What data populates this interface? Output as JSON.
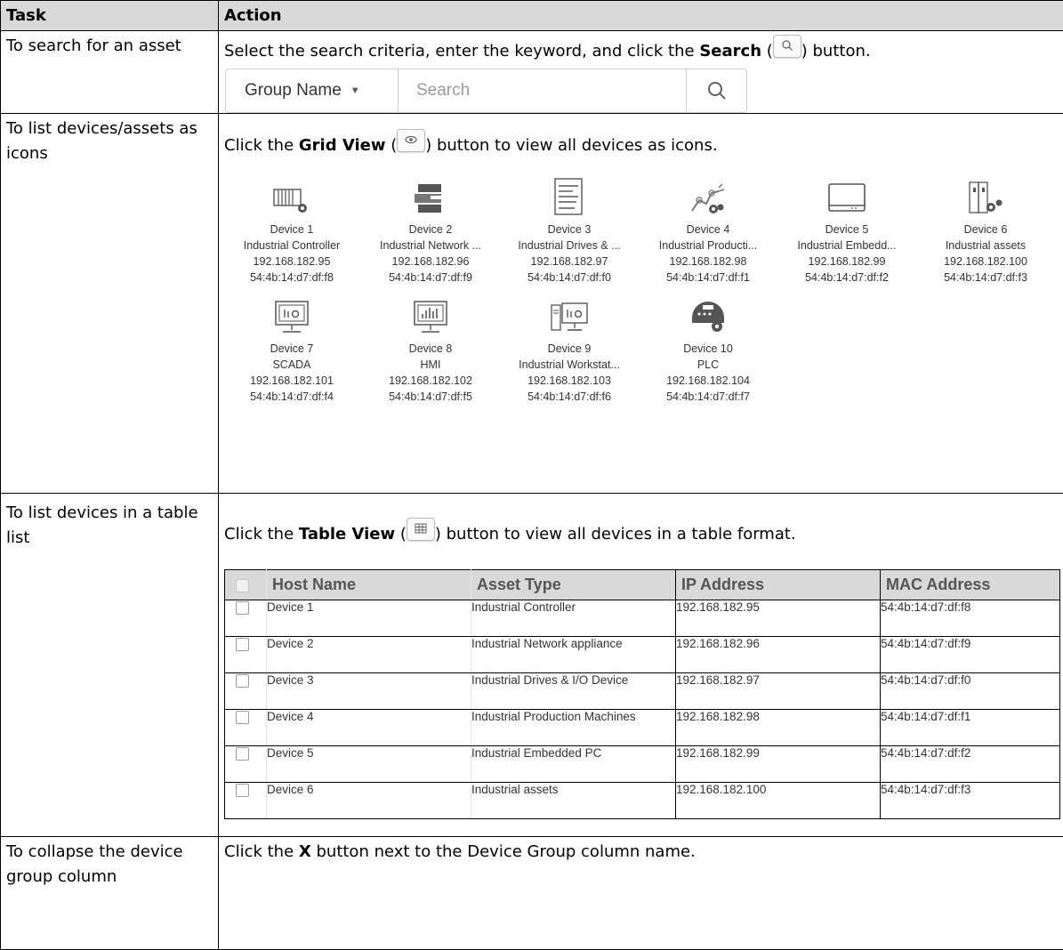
{
  "headers": {
    "task": "Task",
    "action": "Action"
  },
  "rows": {
    "search": {
      "task": "To search for an asset",
      "pre": "Select the search criteria, enter the keyword, and click the ",
      "bold": "Search",
      "open": " (",
      "post": ") button.",
      "widget": {
        "select": "Group Name",
        "placeholder": "Search"
      }
    },
    "grid": {
      "task": "To list devices/assets as icons",
      "pre": "Click the ",
      "bold": "Grid View",
      "open": " (",
      "post": ") button to view all devices as icons.",
      "devices": [
        {
          "name": "Device 1",
          "type": "Industrial Controller",
          "ip": "192.168.182.95",
          "mac": "54:4b:14:d7:df:f8",
          "icon": "controller-icon"
        },
        {
          "name": "Device 2",
          "type": "Industrial Network ...",
          "ip": "192.168.182.96",
          "mac": "54:4b:14:d7:df:f9",
          "icon": "network-appliance-icon"
        },
        {
          "name": "Device 3",
          "type": "Industrial Drives & ...",
          "ip": "192.168.182.97",
          "mac": "54:4b:14:d7:df:f0",
          "icon": "drives-io-icon"
        },
        {
          "name": "Device 4",
          "type": "Industrial Producti...",
          "ip": "192.168.182.98",
          "mac": "54:4b:14:d7:df:f1",
          "icon": "robot-arm-icon"
        },
        {
          "name": "Device 5",
          "type": "Industrial Embedd...",
          "ip": "192.168.182.99",
          "mac": "54:4b:14:d7:df:f2",
          "icon": "embedded-pc-icon"
        },
        {
          "name": "Device 6",
          "type": "Industrial assets",
          "ip": "192.168.182.100",
          "mac": "54:4b:14:d7:df:f3",
          "icon": "industrial-assets-icon"
        },
        {
          "name": "Device 7",
          "type": "SCADA",
          "ip": "192.168.182.101",
          "mac": "54:4b:14:d7:df:f4",
          "icon": "scada-monitor-icon"
        },
        {
          "name": "Device 8",
          "type": "HMI",
          "ip": "192.168.182.102",
          "mac": "54:4b:14:d7:df:f5",
          "icon": "hmi-monitor-icon"
        },
        {
          "name": "Device 9",
          "type": "Industrial Workstat...",
          "ip": "192.168.182.103",
          "mac": "54:4b:14:d7:df:f6",
          "icon": "workstation-icon"
        },
        {
          "name": "Device 10",
          "type": "PLC",
          "ip": "192.168.182.104",
          "mac": "54:4b:14:d7:df:f7",
          "icon": "plc-icon"
        }
      ]
    },
    "table": {
      "task": "To list devices in a table list",
      "pre": "Click the ",
      "bold": "Table View",
      "open": " (",
      "post": ") button to view all devices in a table format.",
      "columns": [
        "Host Name",
        "Asset Type",
        "IP Address",
        "MAC Address"
      ],
      "rows": [
        [
          "Device 1",
          "Industrial Controller",
          "192.168.182.95",
          "54:4b:14:d7:df:f8"
        ],
        [
          "Device 2",
          "Industrial Network appliance",
          "192.168.182.96",
          "54:4b:14:d7:df:f9"
        ],
        [
          "Device 3",
          "Industrial Drives & I/O Device",
          "192.168.182.97",
          "54:4b:14:d7:df:f0"
        ],
        [
          "Device 4",
          "Industrial Production Machines",
          "192.168.182.98",
          "54:4b:14:d7:df:f1"
        ],
        [
          "Device 5",
          "Industrial Embedded PC",
          "192.168.182.99",
          "54:4b:14:d7:df:f2"
        ],
        [
          "Device 6",
          "Industrial assets",
          "192.168.182.100",
          "54:4b:14:d7:df:f3"
        ]
      ]
    },
    "collapse": {
      "task": "To collapse the device group column",
      "pre": "Click the ",
      "bold": "X",
      "post": " button next to the Device Group column name."
    }
  }
}
